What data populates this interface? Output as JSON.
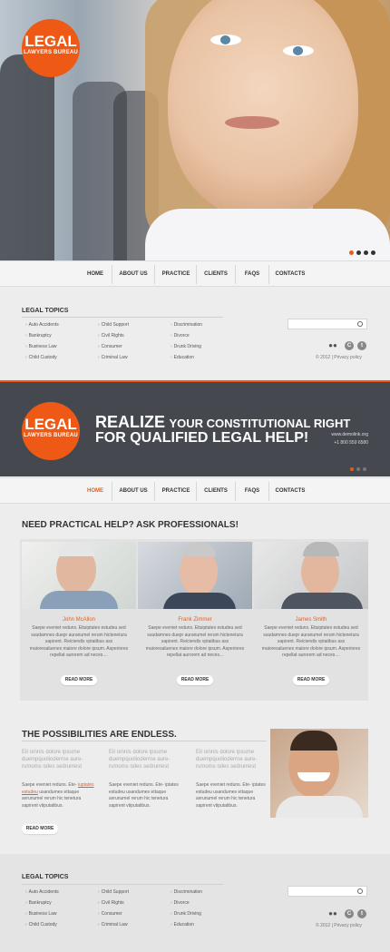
{
  "brand": {
    "name": "LEGAL",
    "tagline": "LAWYERS BUREAU",
    "accent": "#ee5a15"
  },
  "nav": {
    "items": [
      "HOME",
      "ABOUT US",
      "PRACTICE",
      "CLIENTS",
      "FAQS",
      "CONTACTS"
    ]
  },
  "topics": {
    "title": "LEGAL TOPICS",
    "col1": [
      "Auto Accidents",
      "Bankruptcy",
      "Business Law",
      "Child Custody"
    ],
    "col2": [
      "Child Support",
      "Civil Rights",
      "Consumer",
      "Criminal Law"
    ],
    "col3": [
      "Discrimination",
      "Divorce",
      "Drunk Driving",
      "Education"
    ]
  },
  "footer": {
    "copyright": "© 2012 | Privacy policy"
  },
  "banner": {
    "line1_bold": "REALIZE",
    "line1_rest": "YOUR CONSTITUTIONAL RIGHT",
    "line2": "FOR QUALIFIED LEGAL HELP!",
    "site": "www.demolink.org",
    "phone": "+1 800 559 6580"
  },
  "professionals": {
    "heading": "NEED PRACTICAL HELP? ASK PROFESSIONALS!",
    "people": [
      {
        "name": "John McAllon",
        "text": "Saepe eveniet reduns. Etiuiptates estudeu sed suudamnes duepr auranumel rerum hictenetura sapirent. Reiciendis vptatibus ass maioresaluenes maiore dolore ipsum. Asperiores repellat aurorem ad neces...."
      },
      {
        "name": "Frank Zimmer",
        "text": "Saepe eveniet reduns. Etiuiptates estudeu sed suudamnes duepr auranumel rerum hictenetura sapirent. Reiciendis vptatibus ass maioresaluenes maiore dolore ipsum. Asperiores repellat aurorem ad neces..."
      },
      {
        "name": "James Smith",
        "text": "Saepe eveniet reduns. Etiuiptates estudeu sed suudamnes duepr auranumel rerum hictenetura sapirent. Reiciendis vptatibus ass maioresaluenes maiore dolore ipsum. Asperiores repellat aurorem ad neces...."
      }
    ],
    "read_more": "READ MORE"
  },
  "possibilities": {
    "heading": "THE POSSIBILITIES ARE ENDLESS.",
    "cols": [
      {
        "gray": "Eit omnis dolore ipsume duempquolioderrne aure-rumoms odes sedrumest",
        "text_link": "Saepe eveniet reduns. Ete-",
        "text_under": "iuptates estudeu",
        "text_rest": "usandumes ettaque avrunumel rerum hic tenetura sapirent vtiputatibus."
      },
      {
        "gray": "Eit omnis dolore ipsume duempquolioderrne aure-rumoms odes sedrumest",
        "text_link": "Saepe eveniet reduns. Ete-",
        "text_under": "",
        "text_rest": "iptates estudeu usandumes ettaque avrunumel rerum hic tenetura sapirent vtiputatibus."
      },
      {
        "gray": "Eit omnis dolore ipsume duempquolioderrne aure-rumoms odes sedrumest",
        "text_link": "Saepe eveniet reduns. Ete-",
        "text_under": "",
        "text_rest": "iptates estudeu usandumes ettaque avrunumel rerum hic tenetura sapirent vtiputatibus."
      }
    ],
    "read_more": "READ MORE"
  }
}
